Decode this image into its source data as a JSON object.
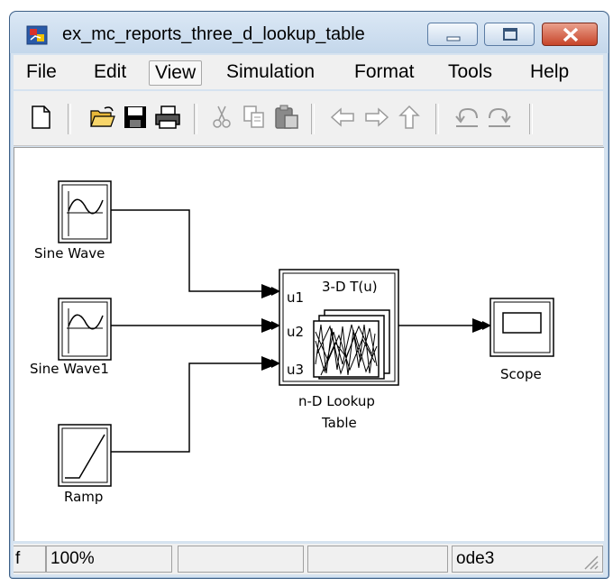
{
  "window": {
    "title": "ex_mc_reports_three_d_lookup_table"
  },
  "menu": {
    "items": [
      "File",
      "Edit",
      "View",
      "Simulation",
      "Format",
      "Tools",
      "Help"
    ],
    "active": "View"
  },
  "toolbar": {
    "icons": [
      "new-file-icon",
      "open-folder-icon",
      "save-icon",
      "print-icon",
      "cut-icon",
      "copy-icon",
      "paste-icon",
      "back-arrow-icon",
      "forward-arrow-icon",
      "up-arrow-icon",
      "undo-icon",
      "redo-icon"
    ]
  },
  "diagram": {
    "blocks": {
      "sine_wave": {
        "label": "Sine Wave"
      },
      "sine_wave1": {
        "label": "Sine Wave1"
      },
      "ramp": {
        "label": "Ramp"
      },
      "lookup": {
        "title": "3-D T(u)",
        "ports": [
          "u1",
          "u2",
          "u3"
        ],
        "label_line1": "n-D Lookup",
        "label_line2": "Table"
      },
      "scope": {
        "label": "Scope"
      }
    }
  },
  "status": {
    "left_clip": "f",
    "zoom": "100%",
    "solver": "ode3"
  }
}
